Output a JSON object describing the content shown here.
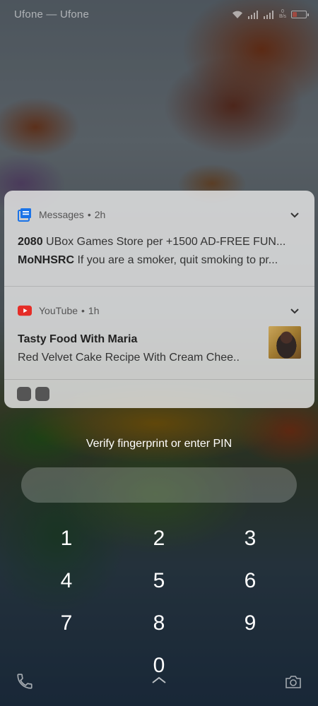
{
  "status_bar": {
    "carrier": "Ufone — Ufone",
    "speed_value": "0",
    "speed_unit": "B/s",
    "icons": [
      "wifi-icon",
      "signal-icon",
      "signal-icon",
      "battery-icon"
    ]
  },
  "notifications": [
    {
      "app": "Messages",
      "time": "2h",
      "icon": "messages-icon",
      "lines": [
        {
          "sender": "2080",
          "text": "UBox Games Store per +1500 AD-FREE FUN..."
        },
        {
          "sender": "MoNHSRC",
          "text": "If you are a smoker, quit smoking to pr..."
        }
      ]
    },
    {
      "app": "YouTube",
      "time": "1h",
      "icon": "youtube-icon",
      "title": "Tasty Food With Maria",
      "text": "Red Velvet Cake Recipe With Cream Chee..",
      "thumbnail": "video-thumbnail"
    }
  ],
  "lock": {
    "prompt": "Verify fingerprint or enter PIN",
    "keys": [
      "1",
      "2",
      "3",
      "4",
      "5",
      "6",
      "7",
      "8",
      "9",
      "0"
    ]
  },
  "colors": {
    "battery_low": "#e24b3b",
    "messages_blue": "#1a73e8",
    "youtube_red": "#e52d27"
  }
}
